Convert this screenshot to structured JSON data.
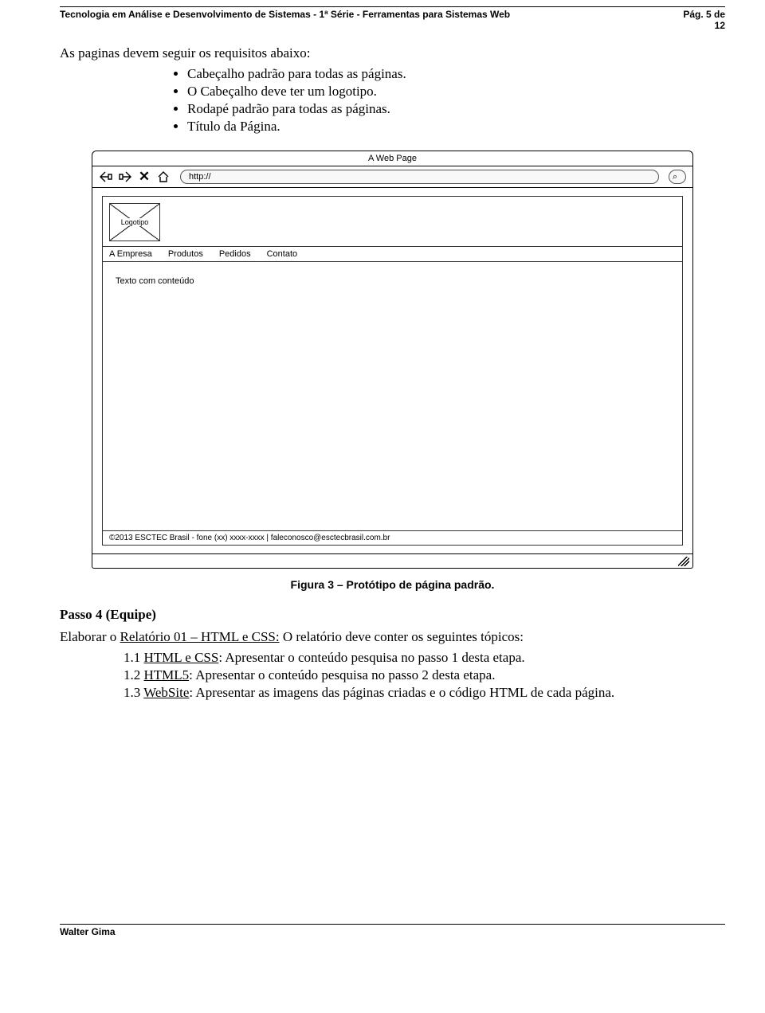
{
  "header": {
    "left": "Tecnologia em Análise e Desenvolvimento de Sistemas - 1ª Série - Ferramentas para Sistemas Web",
    "right_line1": "Pág. 5 de",
    "right_line2": "12"
  },
  "intro": "As paginas devem seguir os requisitos abaixo:",
  "bullets": [
    "Cabeçalho padrão para todas as páginas.",
    "O Cabeçalho deve ter um logotipo.",
    "Rodapé padrão para todas as páginas.",
    "Título da Página."
  ],
  "wireframe": {
    "title": "A Web Page",
    "url_text": "http://",
    "search_glyph": "⌕",
    "logo_label": "Logotipo",
    "nav": [
      "A Empresa",
      "Produtos",
      "Pedidos",
      "Contato"
    ],
    "body_text": "Texto com conteúdo",
    "footer": "©2013  ESCTEC Brasil - fone (xx) xxxx-xxxx | faleconosco@esctecbrasil.com.br",
    "icons": {
      "back": "back-arrow-icon",
      "forward": "forward-arrow-icon",
      "stop": "stop-icon",
      "home": "home-icon"
    }
  },
  "figure_caption": "Figura 3 – Protótipo de página padrão.",
  "passo_heading": "Passo 4 (Equipe)",
  "passo_intro_pre": "Elaborar o ",
  "passo_intro_link": "Relatório 01 – HTML e CSS:",
  "passo_intro_post": " O relatório deve conter os seguintes tópicos:",
  "subitems": [
    {
      "num": "1.1 ",
      "link": "HTML e CSS",
      "rest": ": Apresentar o conteúdo pesquisa no passo 1 desta etapa."
    },
    {
      "num": "1.2 ",
      "link": "HTML5",
      "rest": ": Apresentar o conteúdo pesquisa no passo 2 desta etapa."
    },
    {
      "num": "1.3 ",
      "link": "WebSite",
      "rest": ": Apresentar as imagens das páginas criadas e o código HTML de cada página."
    }
  ],
  "footer": "Walter Gima"
}
